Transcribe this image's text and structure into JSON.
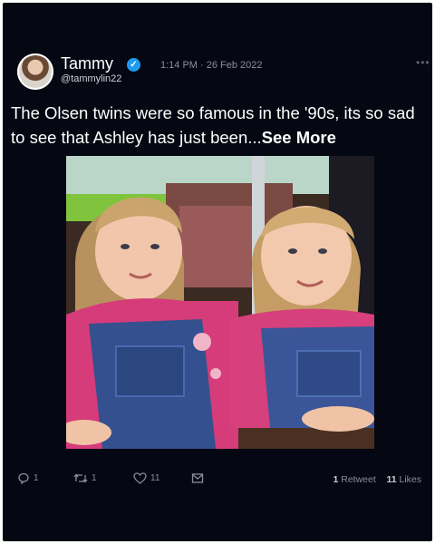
{
  "author": {
    "name": "Tammy",
    "handle": "@tammylin22",
    "timestamp": "1:14 PM · 26 Feb 2022"
  },
  "tweet": {
    "text": "The Olsen twins were so famous in the '90s, its so sad to see that Ashley has just been...",
    "see_more": "See More"
  },
  "actions": {
    "reply_count": "1",
    "retweet_count": "1",
    "like_count": "11"
  },
  "stats": {
    "retweets_number": "1",
    "retweets_label": "Retweet",
    "likes_number": "11",
    "likes_label": "Likes"
  },
  "colors": {
    "background": "#050712",
    "verified": "#1d9bf0",
    "muted_text": "#8b8f99"
  },
  "icons": [
    "verified-badge-icon",
    "more-options-icon",
    "reply-icon",
    "retweet-icon",
    "like-icon",
    "share-icon"
  ]
}
